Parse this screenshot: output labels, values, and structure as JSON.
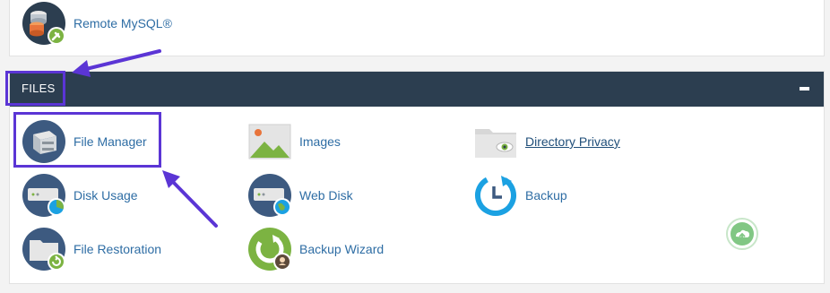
{
  "top_item": {
    "label": "Remote MySQL®",
    "icon": "remote-mysql-icon"
  },
  "files": {
    "title": "FILES",
    "collapse_icon": "minus-icon",
    "items": [
      {
        "label": "File Manager",
        "icon": "file-manager-icon"
      },
      {
        "label": "Images",
        "icon": "images-icon"
      },
      {
        "label": "Directory Privacy",
        "icon": "directory-privacy-icon"
      },
      {
        "label": "Disk Usage",
        "icon": "disk-usage-icon"
      },
      {
        "label": "Web Disk",
        "icon": "web-disk-icon"
      },
      {
        "label": "Backup",
        "icon": "backup-icon"
      },
      {
        "label": "File Restoration",
        "icon": "file-restoration-icon"
      },
      {
        "label": "Backup Wizard",
        "icon": "backup-wizard-icon"
      }
    ]
  },
  "colors": {
    "header_bg": "#2c3e50",
    "link": "#2e6da4",
    "annotation": "#5b35d5",
    "accent_green": "#7cb342",
    "accent_blue": "#1ba1e2"
  }
}
